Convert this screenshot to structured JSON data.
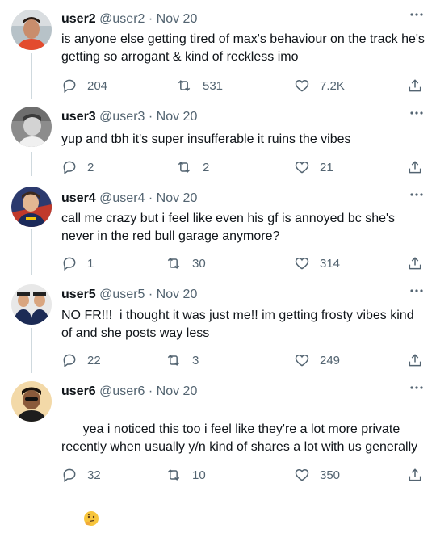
{
  "tweets": [
    {
      "name": "user2",
      "handle": "@user2",
      "separator": "·",
      "date": "Nov 20",
      "text": "is anyone else getting tired of max's behaviour on the track he's getting so arrogant & kind of reckless imo",
      "replies": "204",
      "retweets": "531",
      "likes": "7.2K"
    },
    {
      "name": "user3",
      "handle": "@user3",
      "separator": "·",
      "date": "Nov 20",
      "text": "yup and tbh it's super insufferable it ruins the vibes",
      "replies": "2",
      "retweets": "2",
      "likes": "21"
    },
    {
      "name": "user4",
      "handle": "@user4",
      "separator": "·",
      "date": "Nov 20",
      "text": "call me crazy but i feel like even his gf is annoyed bc she's never in the red bull garage anymore?",
      "replies": "1",
      "retweets": "30",
      "likes": "314"
    },
    {
      "name": "user5",
      "handle": "@user5",
      "separator": "·",
      "date": "Nov 20",
      "text": "NO FR!!!  i thought it was just me!! im getting frosty vibes kind of and she posts way less",
      "replies": "22",
      "retweets": "3",
      "likes": "249"
    },
    {
      "name": "user6",
      "handle": "@user6",
      "separator": "·",
      "date": "Nov 20",
      "text": "yea i noticed this too i feel like they're a lot more private recently when usually y/n kind of shares a lot with us generally",
      "emoji": "thinking-face-emoji",
      "replies": "32",
      "retweets": "10",
      "likes": "350"
    }
  ],
  "icons": {
    "more": "more-dots-icon",
    "reply": "reply-icon",
    "retweet": "retweet-icon",
    "like": "heart-icon",
    "share": "share-icon"
  },
  "colors": {
    "text": "#0f1419",
    "secondary": "#536471",
    "thread_line": "#cfd9de"
  }
}
